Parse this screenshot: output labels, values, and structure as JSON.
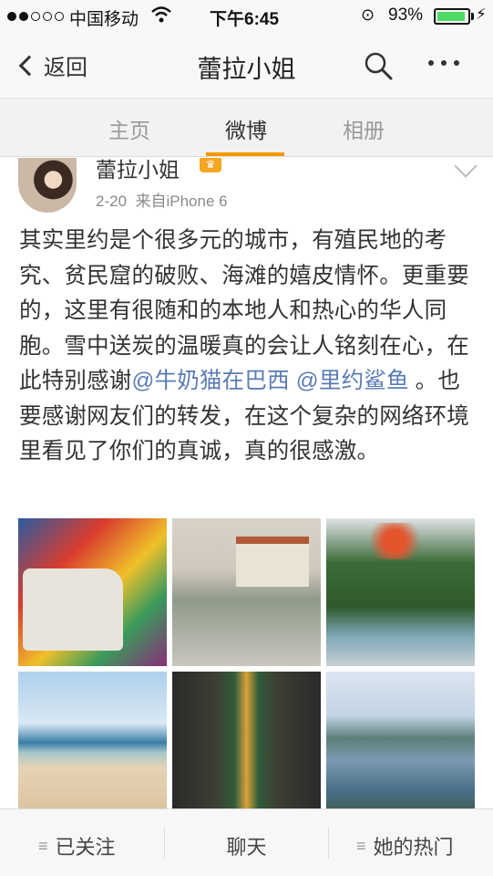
{
  "status_bar": {
    "carrier": "中国移动",
    "time": "下午6:45",
    "battery_percent": "93%",
    "battery_level": 0.93,
    "signal_bars_filled": 2,
    "signal_bars_total": 5,
    "icons": [
      "wifi-icon",
      "rotation-lock-icon",
      "battery-icon",
      "charging-icon"
    ]
  },
  "nav": {
    "back_label": "返回",
    "title": "蕾拉小姐",
    "icons": [
      "chevron-left-icon",
      "search-icon",
      "more-icon"
    ]
  },
  "tabs": [
    {
      "label": "主页",
      "active": false
    },
    {
      "label": "微博",
      "active": true
    },
    {
      "label": "相册",
      "active": false
    }
  ],
  "accent_color": "#f39800",
  "mention_color": "#5a7bb5",
  "post": {
    "author": "蕾拉小姐",
    "date": "2-20",
    "source": "来自iPhone 6",
    "text_before": "其实里约是个很多元的城市，有殖民地的考究、贫民窟的破败、海滩的嬉皮情怀。更重要的，这里有很随和的本地人和热心的华人同胞。雪中送炭的温暖真的会让人铭刻在心，在此特别感谢",
    "mention_1": "@牛奶猫在巴西",
    "mention_2": "@里约鲨鱼",
    "text_after": " 。也要感谢网友们的转发，在这个复杂的网络环境里看见了你们的真诚，真的很感激。",
    "photo_count": 6
  },
  "bottom_bar": {
    "follow_label": "已关注",
    "chat_label": "聊天",
    "hot_label": "她的热门"
  }
}
